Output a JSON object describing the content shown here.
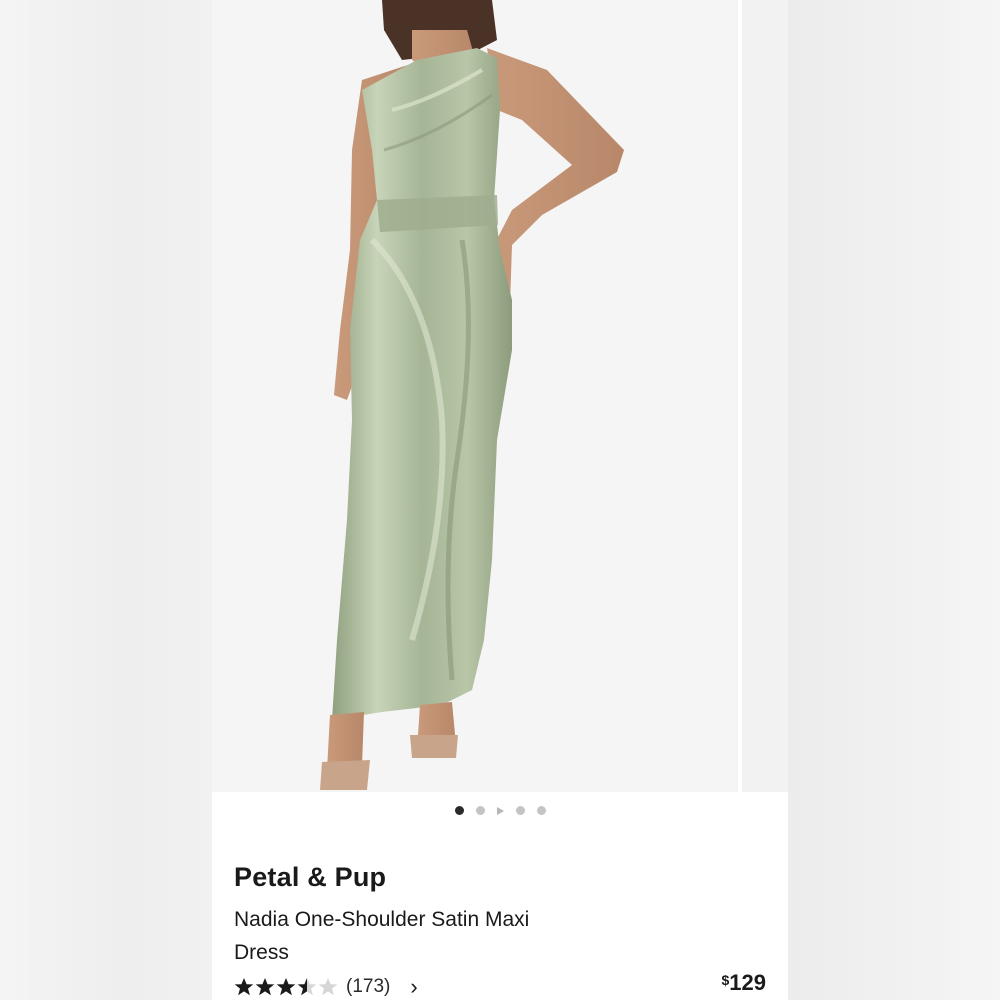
{
  "carousel": {
    "total_slides": 5,
    "active_index": 0,
    "photo_alt": "Model wearing sage green one-shoulder satin maxi dress"
  },
  "product": {
    "brand": "Petal & Pup",
    "name": "Nadia One-Shoulder Satin Maxi Dress",
    "rating": 3.5,
    "rating_max": 5,
    "review_count": "(173)",
    "price_currency": "$",
    "price_amount": "129"
  },
  "icons": {
    "reviews_link": "chevron-right-icon",
    "rating": "star-icon"
  },
  "colors": {
    "dress": "#a9b89a",
    "star_filled": "#1a1a1a",
    "star_empty": "#d6d6d6",
    "dot_active": "#2a2a2a",
    "dot_inactive": "#c4c4c4"
  }
}
